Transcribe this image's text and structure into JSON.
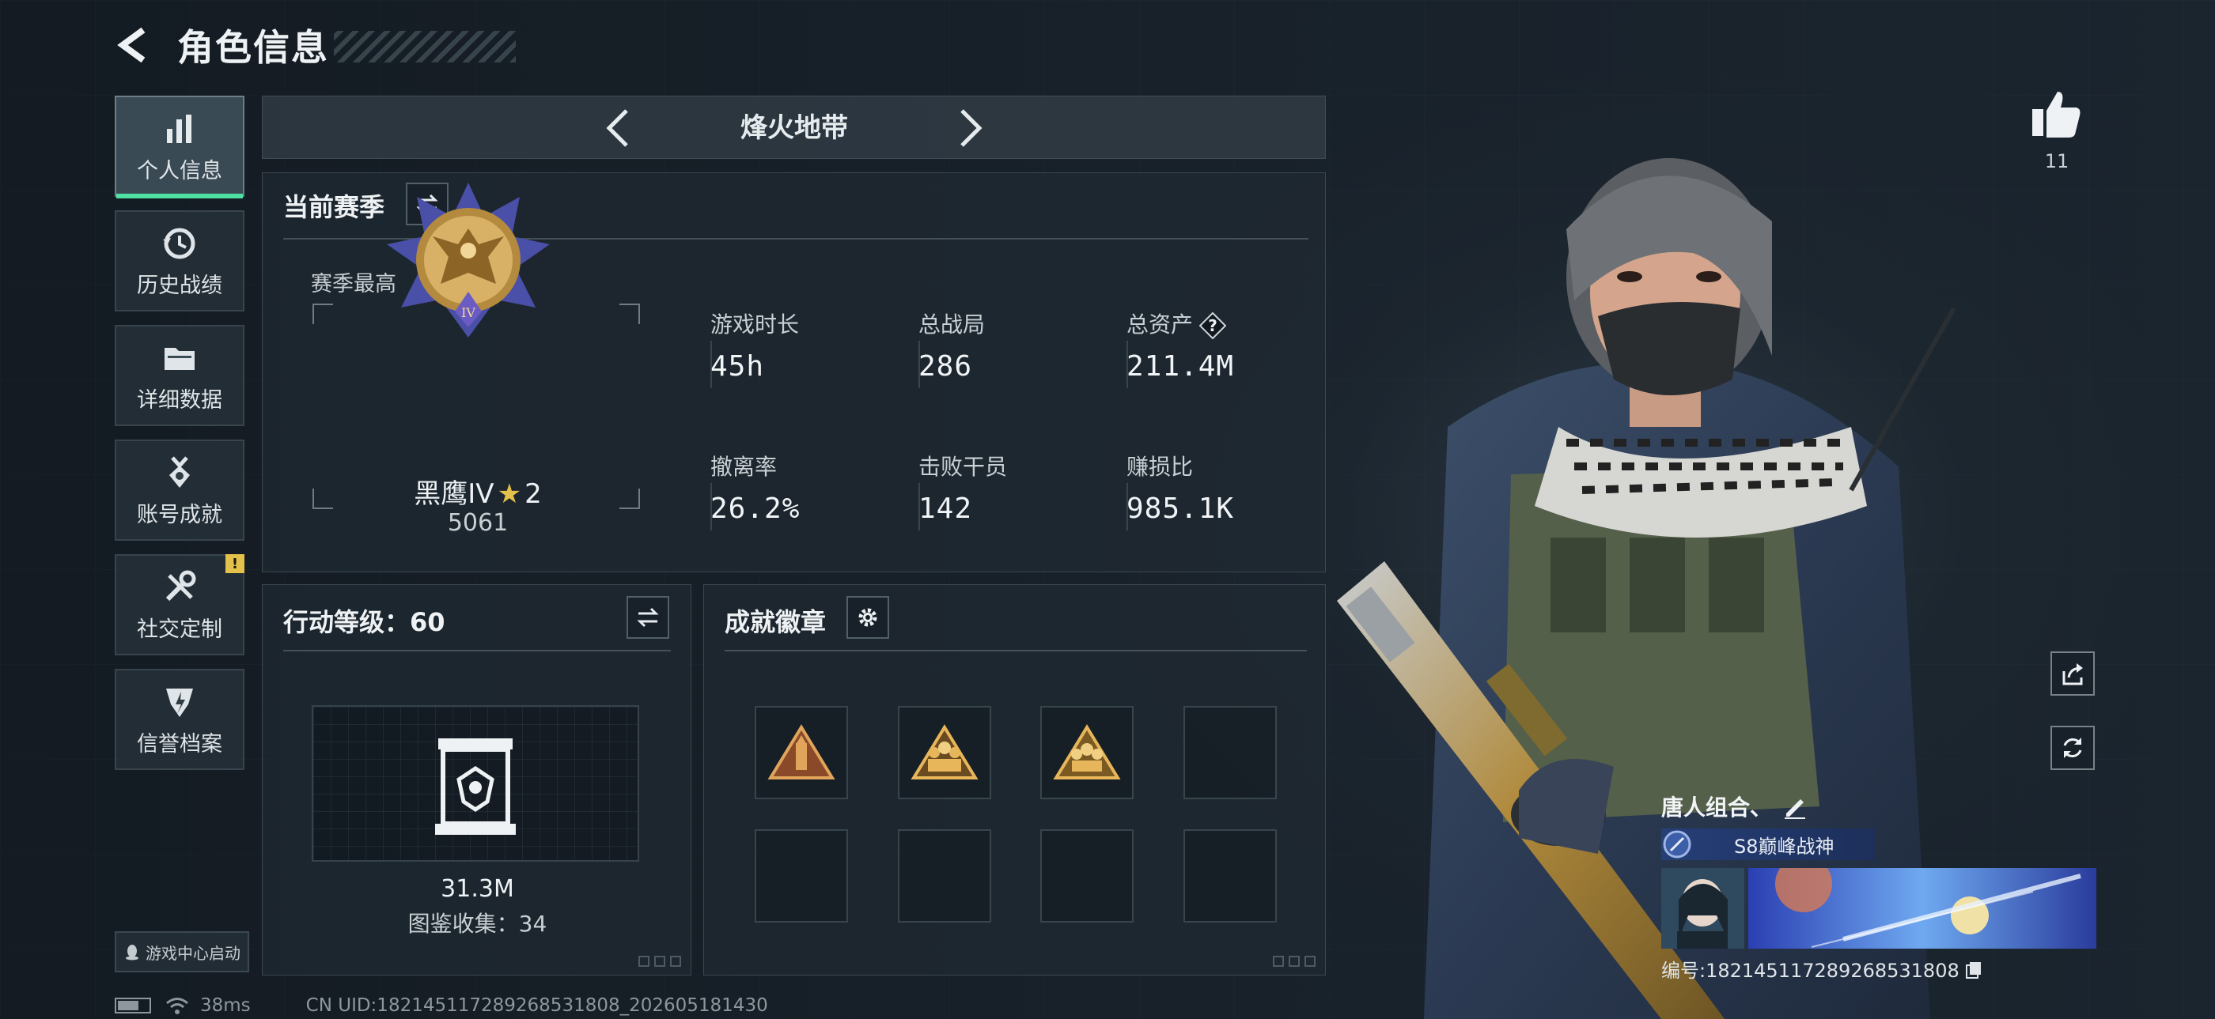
{
  "header": {
    "title": "角色信息"
  },
  "sidebar": {
    "items": [
      {
        "label": "个人信息",
        "icon": "bar-chart-icon"
      },
      {
        "label": "历史战绩",
        "icon": "history-clock-icon"
      },
      {
        "label": "详细数据",
        "icon": "folder-icon"
      },
      {
        "label": "账号成就",
        "icon": "medal-icon"
      },
      {
        "label": "社交定制",
        "icon": "tools-icon",
        "badge": "!"
      },
      {
        "label": "信誉档案",
        "icon": "shield-icon"
      }
    ],
    "launch_label": "游戏中心启动"
  },
  "mode": {
    "title": "烽火地带"
  },
  "season": {
    "title": "当前赛季",
    "best_label": "赛季最高",
    "rank_name": "黑鹰IV",
    "rank_stars": "2",
    "rank_score": "5061",
    "stats": [
      {
        "label": "游戏时长",
        "value": "45h"
      },
      {
        "label": "总战局",
        "value": "286"
      },
      {
        "label": "总资产",
        "value": "211.4M",
        "help": true
      },
      {
        "label": "撤离率",
        "value": "26.2%"
      },
      {
        "label": "击败干员",
        "value": "142"
      },
      {
        "label": "赚损比",
        "value": "985.1K"
      }
    ]
  },
  "level": {
    "title": "行动等级：60",
    "value": "31.3M",
    "collection": "图鉴收集：34"
  },
  "achievements": {
    "title": "成就徽章",
    "slots": [
      "bronze",
      "gold",
      "gold",
      "empty",
      "empty",
      "empty",
      "empty",
      "empty"
    ]
  },
  "likes": {
    "count": "11"
  },
  "player": {
    "name": "唐人组合、",
    "title_badge": "S8巅峰战神",
    "id_text": "编号:182145117289268531808"
  },
  "status": {
    "ping": "38ms",
    "uid": "CN UID:182145117289268531808_202605181430"
  },
  "colors": {
    "accent": "#4fe0a3",
    "badge_yellow": "#e4c14a",
    "gold": "#c9a24b"
  }
}
